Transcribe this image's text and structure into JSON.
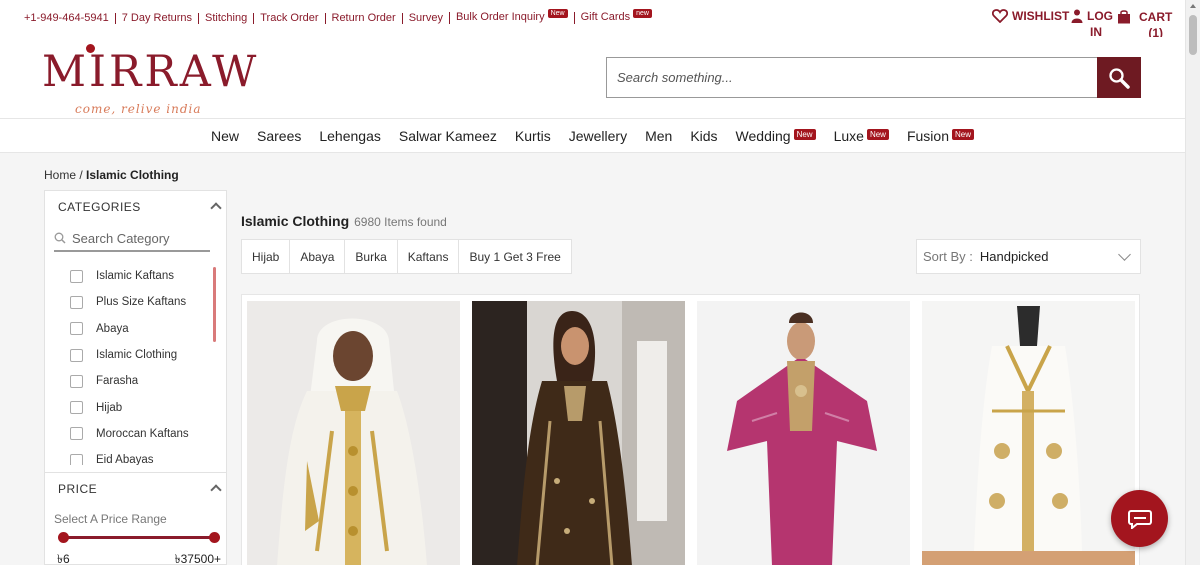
{
  "topbar": {
    "phone": "+1-949-464-5941",
    "links": [
      {
        "label": "7 Day Returns"
      },
      {
        "label": "Stitching"
      },
      {
        "label": "Track Order"
      },
      {
        "label": "Return Order"
      },
      {
        "label": "Survey"
      },
      {
        "label": "Bulk Order Inquiry",
        "badge": "New"
      },
      {
        "label": "Gift Cards",
        "badge": "new"
      }
    ],
    "wishlist": "WISHLIST",
    "login_line1": "LOG",
    "login_line2": "IN",
    "cart": "CART",
    "cart_count": "(1)"
  },
  "header": {
    "logo_text": "MIRRAW",
    "logo_tagline": "come, relive india",
    "search_placeholder": "Search something..."
  },
  "nav": [
    {
      "label": "New"
    },
    {
      "label": "Sarees"
    },
    {
      "label": "Lehengas"
    },
    {
      "label": "Salwar Kameez"
    },
    {
      "label": "Kurtis"
    },
    {
      "label": "Jewellery"
    },
    {
      "label": "Men"
    },
    {
      "label": "Kids"
    },
    {
      "label": "Wedding",
      "badge": "New"
    },
    {
      "label": "Luxe",
      "badge": "New"
    },
    {
      "label": "Fusion",
      "badge": "New"
    }
  ],
  "breadcrumb": {
    "home": "Home",
    "sep": " / ",
    "current": "Islamic Clothing"
  },
  "sidebar": {
    "categories_title": "CATEGORIES",
    "search_placeholder": "Search Category",
    "categories": [
      "Islamic Kaftans",
      "Plus Size Kaftans",
      "Abaya",
      "Islamic Clothing",
      "Farasha",
      "Hijab",
      "Moroccan Kaftans",
      "Eid Abayas"
    ],
    "price_title": "PRICE",
    "price_label": "Select A Price Range",
    "price_min": "৳6",
    "price_max": "৳37500+"
  },
  "main": {
    "title": "Islamic Clothing",
    "count": "6980 Items found",
    "chips": [
      "Hijab",
      "Abaya",
      "Burka",
      "Kaftans",
      "Buy 1 Get 3 Free"
    ],
    "sort_label": "Sort By :",
    "sort_value": "Handpicked"
  },
  "colors": {
    "brand": "#8a1b2b",
    "badge": "#a3151e",
    "search_button": "#6e1a22"
  }
}
